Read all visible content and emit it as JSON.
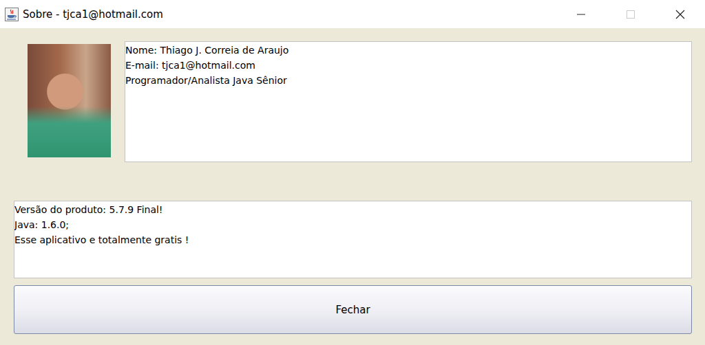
{
  "window": {
    "title": "Sobre - tjca1@hotmail.com",
    "controls": [
      {
        "kind": "minimize",
        "disabled": false
      },
      {
        "kind": "maximize",
        "disabled": true
      },
      {
        "kind": "close",
        "disabled": false
      }
    ]
  },
  "author": {
    "lines": [
      "Nome: Thiago J. Correia de Araujo",
      "E-mail: tjca1@hotmail.com",
      "Programador/Analista Java Sênior"
    ]
  },
  "product": {
    "lines": [
      "Versão do produto: 5.7.9 Final!",
      "Java: 1.6.0;",
      "Esse aplicativo e totalmente gratis !"
    ]
  },
  "buttons": [
    "Fechar"
  ]
}
